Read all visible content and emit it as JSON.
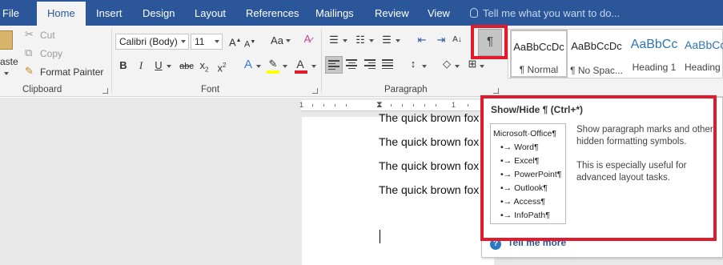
{
  "tabs": [
    "File",
    "Home",
    "Insert",
    "Design",
    "Layout",
    "References",
    "Mailings",
    "Review",
    "View"
  ],
  "tell_me": "Tell me what you want to do...",
  "clipboard": {
    "paste_label": "aste",
    "cut_label": "Cut",
    "copy_label": "Copy",
    "format_painter_label": "Format Painter",
    "group_label": "Clipboard"
  },
  "font": {
    "font_name": "Calibri (Body)",
    "font_size": "11",
    "group_label": "Font",
    "aa_label": "Aa"
  },
  "paragraph": {
    "group_label": "Paragraph",
    "show_hide_glyph": "¶"
  },
  "styles": [
    {
      "preview": "AaBbCcDc",
      "name": "¶ Normal"
    },
    {
      "preview": "AaBbCcDc",
      "name": "¶ No Spac..."
    },
    {
      "preview": "AaBbCc",
      "name": "Heading 1"
    },
    {
      "preview": "AaBbCc",
      "name": "Heading"
    }
  ],
  "ruler_numbers": [
    "1",
    "1"
  ],
  "document_lines": [
    "The quick brown fox jumps over the lazy dog.",
    "The quick brown fox jumps over the lazy dog.",
    "The quick brown fox jumps over the lazy dog.",
    "The quick brown fox jumps over the lazy dog."
  ],
  "tooltip": {
    "title": "Show/Hide ¶ (Ctrl+*)",
    "preview_lines": [
      "Microsoft·Office¶",
      "•→ Word¶",
      "•→ Excel¶",
      "•→ PowerPoint¶",
      "•→ Outlook¶",
      "•→ Access¶",
      "•→ InfoPath¶"
    ],
    "description_1": "Show paragraph marks and other hidden formatting symbols.",
    "description_2": "This is especially useful for advanced layout tasks.",
    "footer": "Tell me more"
  },
  "colors": {
    "ribbon_blue": "#2b579a",
    "highlight_red": "#e11b2b",
    "heading_blue": "#2e74b5"
  }
}
